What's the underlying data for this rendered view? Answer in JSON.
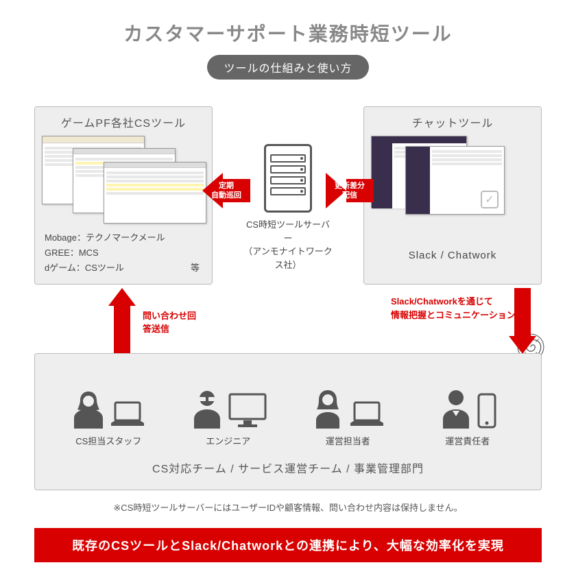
{
  "title": "カスタマーサポート業務時短ツール",
  "subtitle": "ツールの仕組みと使い方",
  "left_box": {
    "title": "ゲームPF各社CSツール",
    "items": [
      "Mobage：テクノマークメール",
      "GREE：MCS",
      "dゲーム：CSツール"
    ],
    "etc": "等"
  },
  "right_box": {
    "title": "チャットツール",
    "footer": "Slack / Chatwork"
  },
  "server": {
    "line1": "CS時短ツールサーバー",
    "line2": "（アンモナイトワークス社）"
  },
  "arrows": {
    "left_label": "定期\n自動巡回",
    "right_label": "更新差分\n配信",
    "up_label": "問い合わせ回答送信",
    "down_label": "Slack/Chatworkを通じて\n情報把握とコミュニケーション"
  },
  "team": {
    "members": [
      {
        "label": "CS担当スタッフ"
      },
      {
        "label": "エンジニア"
      },
      {
        "label": "運営担当者"
      },
      {
        "label": "運営責任者"
      }
    ],
    "footer": "CS対応チーム / サービス運営チーム / 事業管理部門"
  },
  "note": "※CS時短ツールサーバーにはユーザーIDや顧客情報、問い合わせ内容は保持しません。",
  "banner": "既存のCSツールとSlack/Chatworkとの連携により、大幅な効率化を実現"
}
